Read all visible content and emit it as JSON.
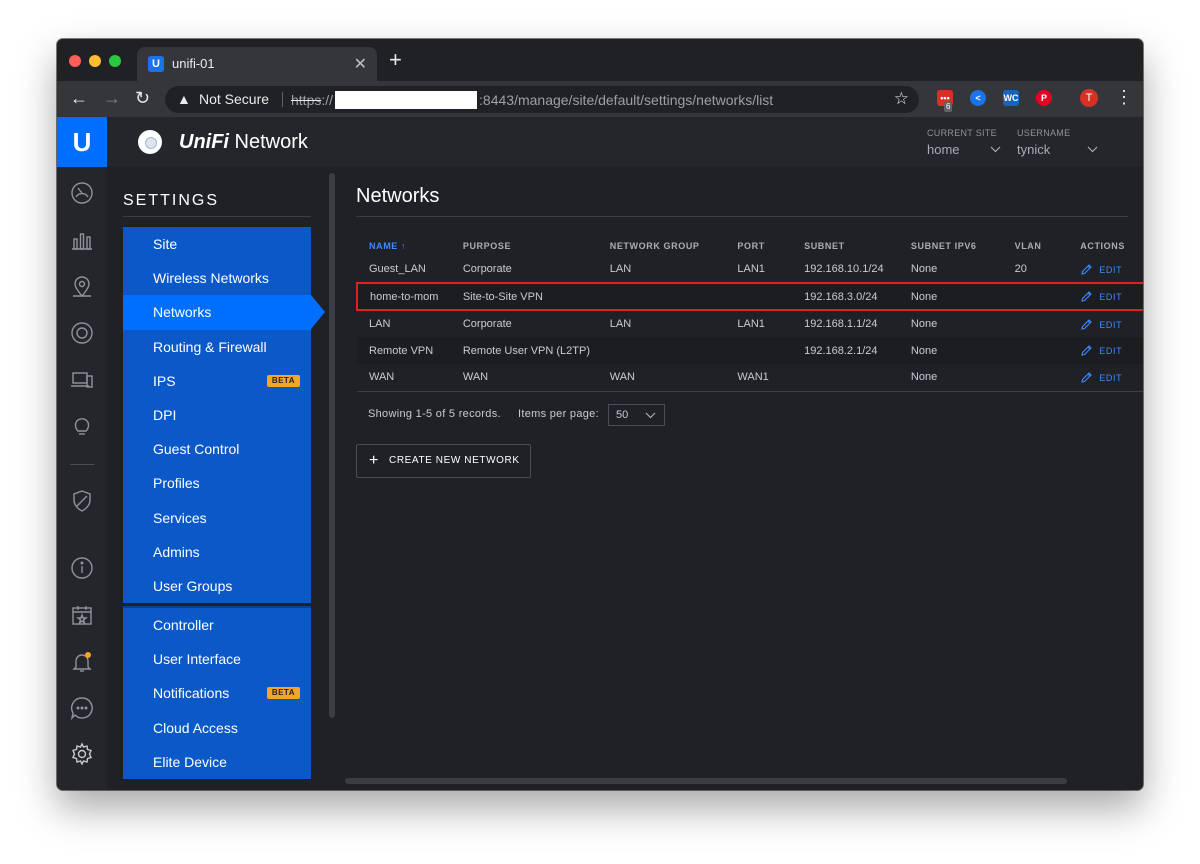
{
  "browser": {
    "tab_title": "unifi-01",
    "tab_icon": "unifi-favicon",
    "not_secure": "Not Secure",
    "url_scheme": "https",
    "url_sep": "://",
    "url_rest": ":8443/manage/site/default/settings/networks/list",
    "extension_badge": "6",
    "profile_initial": "T",
    "icons": [
      "back-arrow",
      "forward-arrow",
      "reload",
      "warning",
      "star",
      "menu-dots"
    ]
  },
  "header": {
    "brand_italic": "UniFi",
    "brand_rest": " Network",
    "current_site_label": "CURRENT SITE",
    "current_site_value": "home",
    "username_label": "USERNAME",
    "username_value": "tynick"
  },
  "settings": {
    "title": "SETTINGS",
    "group1": [
      {
        "label": "Site"
      },
      {
        "label": "Wireless Networks"
      },
      {
        "label": "Networks",
        "active": true
      },
      {
        "label": "Routing & Firewall"
      },
      {
        "label": "IPS",
        "badge": "BETA"
      },
      {
        "label": "DPI"
      },
      {
        "label": "Guest Control"
      },
      {
        "label": "Profiles"
      },
      {
        "label": "Services"
      },
      {
        "label": "Admins"
      },
      {
        "label": "User Groups"
      }
    ],
    "group2": [
      {
        "label": "Controller"
      },
      {
        "label": "User Interface"
      },
      {
        "label": "Notifications",
        "badge": "BETA"
      },
      {
        "label": "Cloud Access"
      },
      {
        "label": "Elite Device"
      }
    ]
  },
  "page": {
    "title": "Networks",
    "columns": [
      "NAME",
      "PURPOSE",
      "NETWORK GROUP",
      "PORT",
      "SUBNET",
      "SUBNET IPV6",
      "VLAN",
      "ACTIONS"
    ],
    "sort_arrow": "↑",
    "rows": [
      {
        "name": "Guest_LAN",
        "purpose": "Corporate",
        "group": "LAN",
        "port": "LAN1",
        "subnet": "192.168.10.1/24",
        "ipv6": "None",
        "vlan": "20",
        "action": "EDIT"
      },
      {
        "name": "home-to-mom",
        "purpose": "Site-to-Site VPN",
        "group": "",
        "port": "",
        "subnet": "192.168.3.0/24",
        "ipv6": "None",
        "vlan": "",
        "action": "EDIT"
      },
      {
        "name": "LAN",
        "purpose": "Corporate",
        "group": "LAN",
        "port": "LAN1",
        "subnet": "192.168.1.1/24",
        "ipv6": "None",
        "vlan": "",
        "action": "EDIT"
      },
      {
        "name": "Remote VPN",
        "purpose": "Remote User VPN (L2TP)",
        "group": "",
        "port": "",
        "subnet": "192.168.2.1/24",
        "ipv6": "None",
        "vlan": "",
        "action": "EDIT"
      },
      {
        "name": "WAN",
        "purpose": "WAN",
        "group": "WAN",
        "port": "WAN1",
        "subnet": "",
        "ipv6": "None",
        "vlan": "",
        "action": "EDIT"
      }
    ],
    "records": "Showing 1-5 of 5 records.",
    "items_per_page_label": "Items per page:",
    "items_per_page_value": "50",
    "create_button": "CREATE NEW NETWORK"
  },
  "colors": {
    "accent": "#006fff",
    "menu": "#0b58c8",
    "highlight": "#e02020",
    "beta": "#f5a623"
  }
}
